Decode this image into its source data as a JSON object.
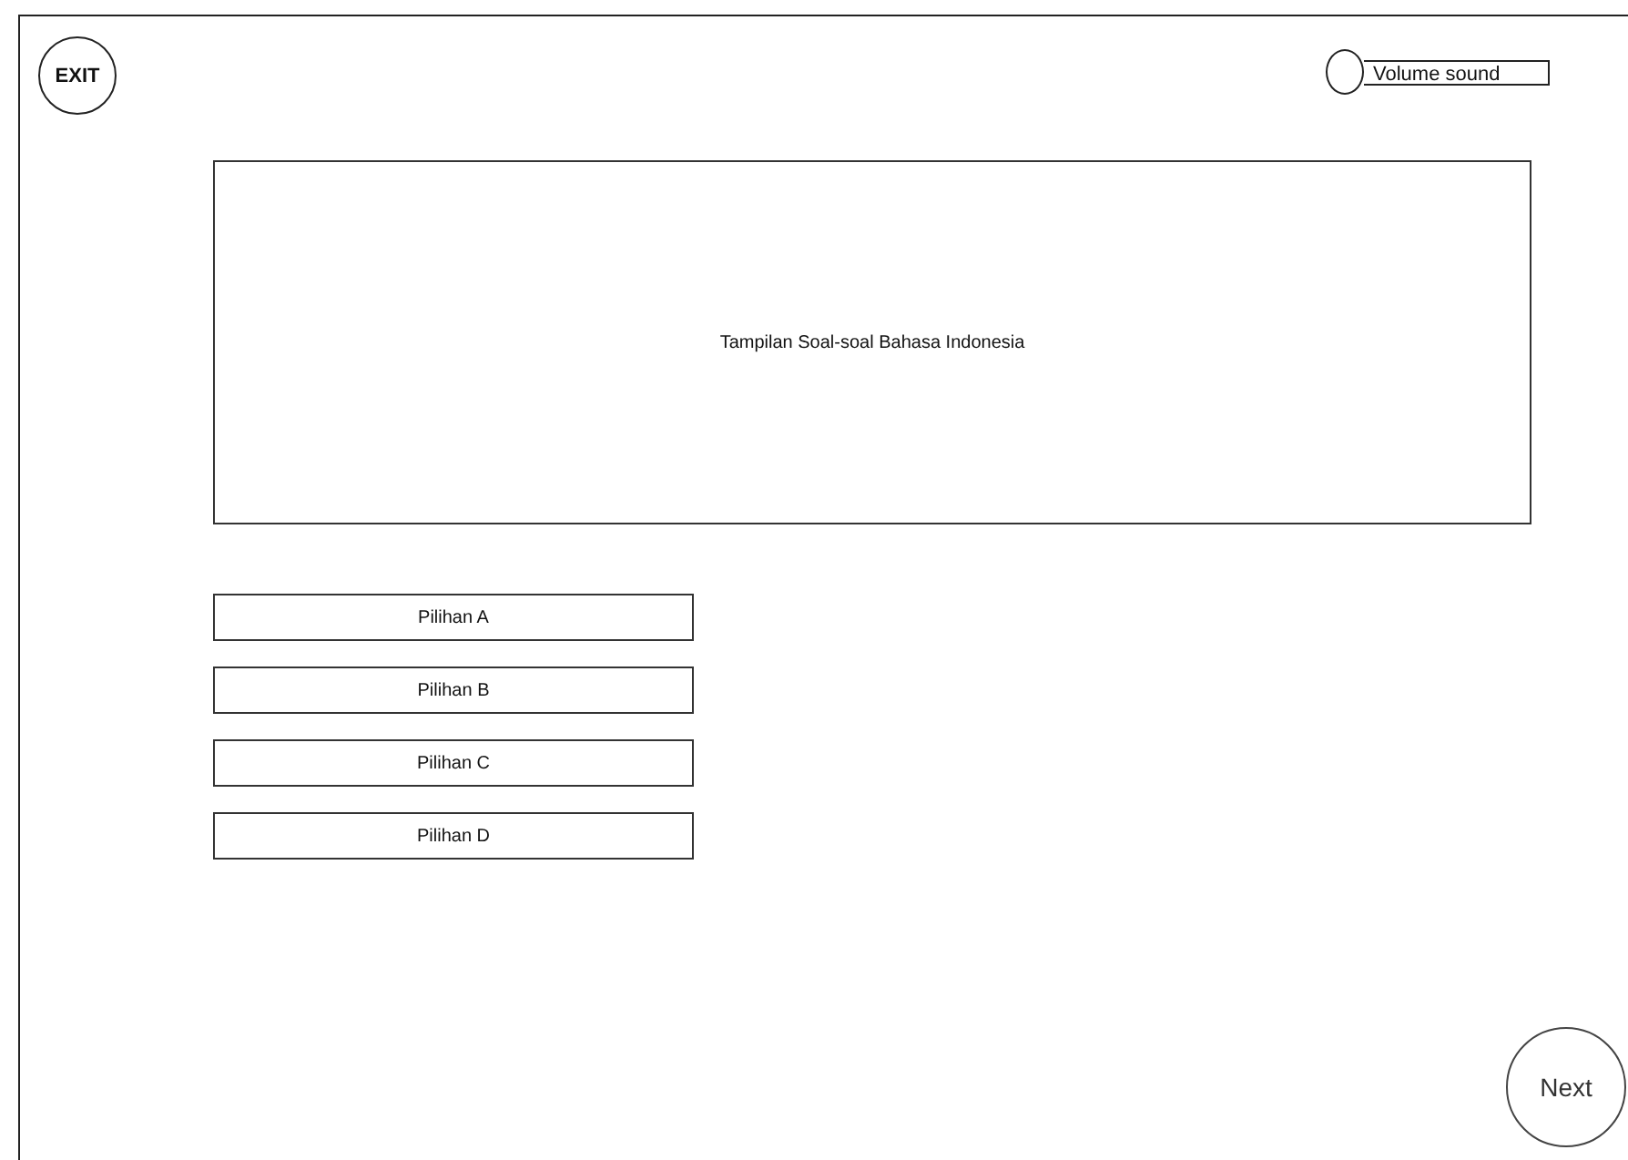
{
  "exit_button": {
    "label": "EXIT"
  },
  "volume": {
    "label": "Volume sound"
  },
  "question": {
    "text": "Tampilan Soal-soal Bahasa Indonesia"
  },
  "options": [
    {
      "label": "Pilihan A"
    },
    {
      "label": "Pilihan B"
    },
    {
      "label": "Pilihan C"
    },
    {
      "label": "Pilihan D"
    }
  ],
  "next_button": {
    "label": "Next"
  }
}
